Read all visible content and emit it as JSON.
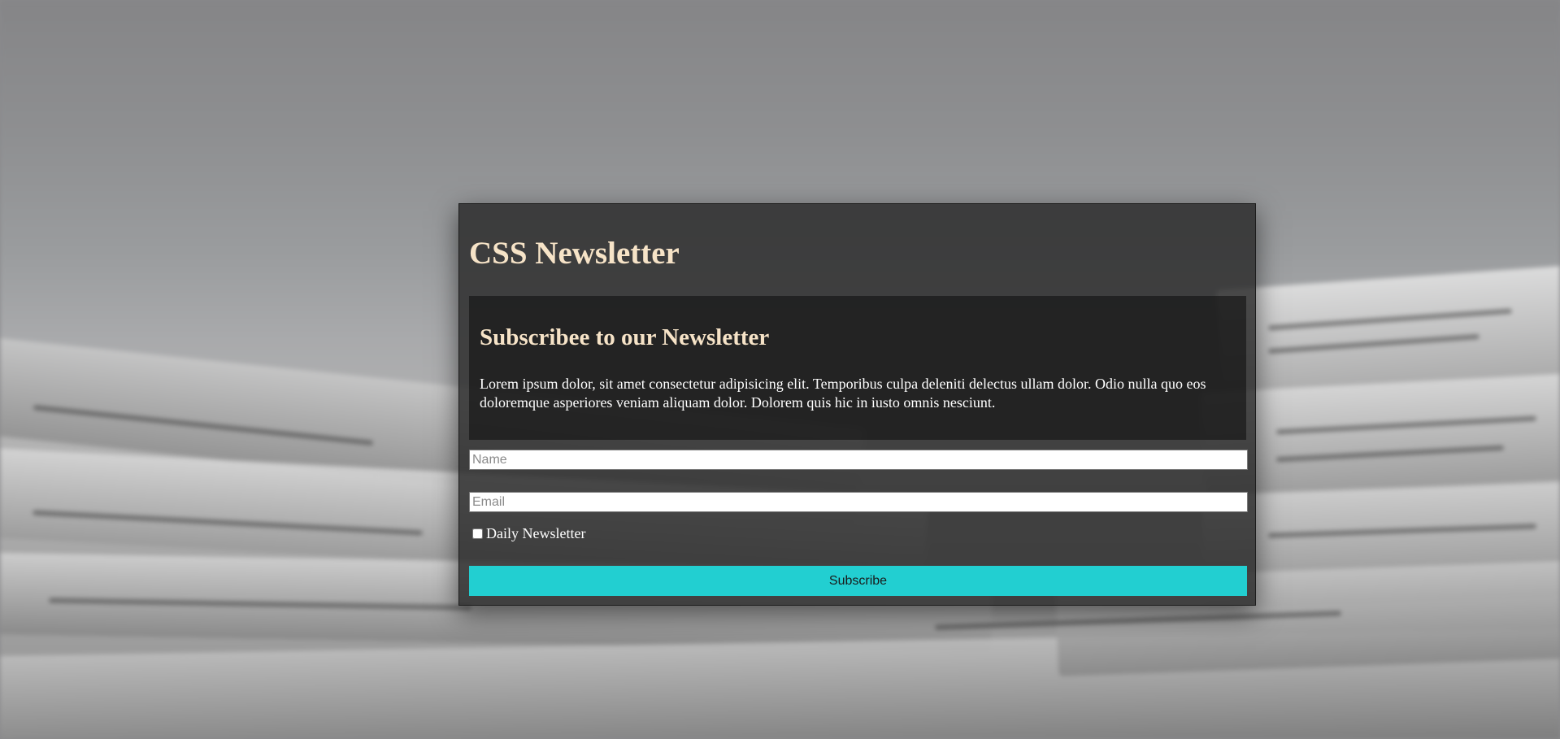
{
  "newsletter": {
    "title": "CSS Newsletter",
    "heading": "Subscribee to our Newsletter",
    "description": "Lorem ipsum dolor, sit amet consectetur adipisicing elit. Temporibus culpa deleniti delectus ullam dolor. Odio nulla quo eos doloremque asperiores veniam aliquam dolor. Dolorem quis hic in iusto omnis nesciunt."
  },
  "form": {
    "name_placeholder": "Name",
    "name_value": "",
    "email_placeholder": "Email",
    "email_value": "",
    "daily_label": "Daily Newsletter",
    "daily_checked": false,
    "subscribe_label": "Subscribe"
  },
  "colors": {
    "title": "#f6e3c7",
    "button": "#22cfd1",
    "card_background": "#282828"
  }
}
